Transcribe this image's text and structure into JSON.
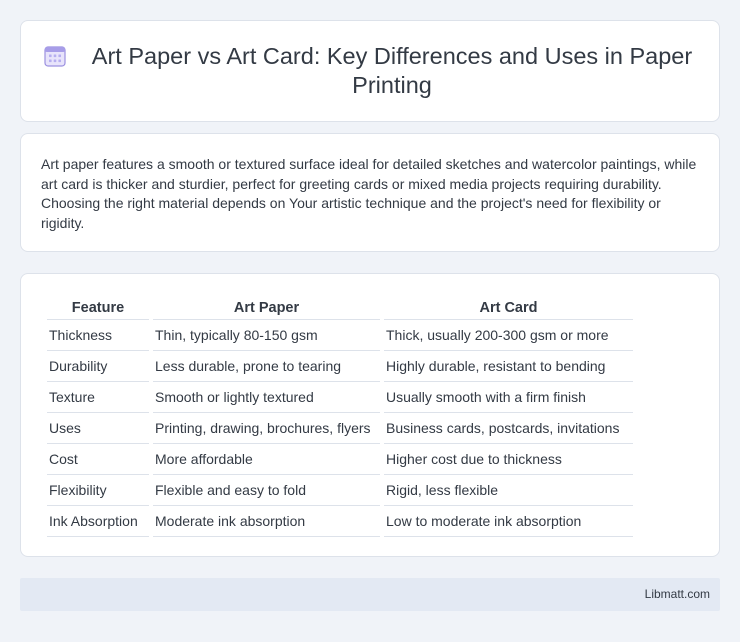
{
  "header": {
    "title": "Art Paper vs Art Card: Key Differences and Uses in Paper Printing",
    "icon": "calendar-icon"
  },
  "intro": {
    "text": "Art paper features a smooth or textured surface ideal for detailed sketches and watercolor paintings, while art card is thicker and sturdier, perfect for greeting cards or mixed media projects requiring durability. Choosing the right material depends on Your artistic technique and the project's need for flexibility or rigidity."
  },
  "table": {
    "headers": [
      "Feature",
      "Art Paper",
      "Art Card"
    ],
    "rows": [
      [
        "Thickness",
        "Thin, typically 80-150 gsm",
        "Thick, usually 200-300 gsm or more"
      ],
      [
        "Durability",
        "Less durable, prone to tearing",
        "Highly durable, resistant to bending"
      ],
      [
        "Texture",
        "Smooth or lightly textured",
        "Usually smooth with a firm finish"
      ],
      [
        "Uses",
        "Printing, drawing, brochures, flyers",
        "Business cards, postcards, invitations"
      ],
      [
        "Cost",
        "More affordable",
        "Higher cost due to thickness"
      ],
      [
        "Flexibility",
        "Flexible and easy to fold",
        "Rigid, less flexible"
      ],
      [
        "Ink Absorption",
        "Moderate ink absorption",
        "Low to moderate ink absorption"
      ]
    ]
  },
  "footer": {
    "link": "Libmatt.com"
  },
  "colors": {
    "background": "#f0f3f8",
    "card": "#ffffff",
    "footer": "#e3e9f3",
    "icon_accent": "#8a7fd6"
  }
}
